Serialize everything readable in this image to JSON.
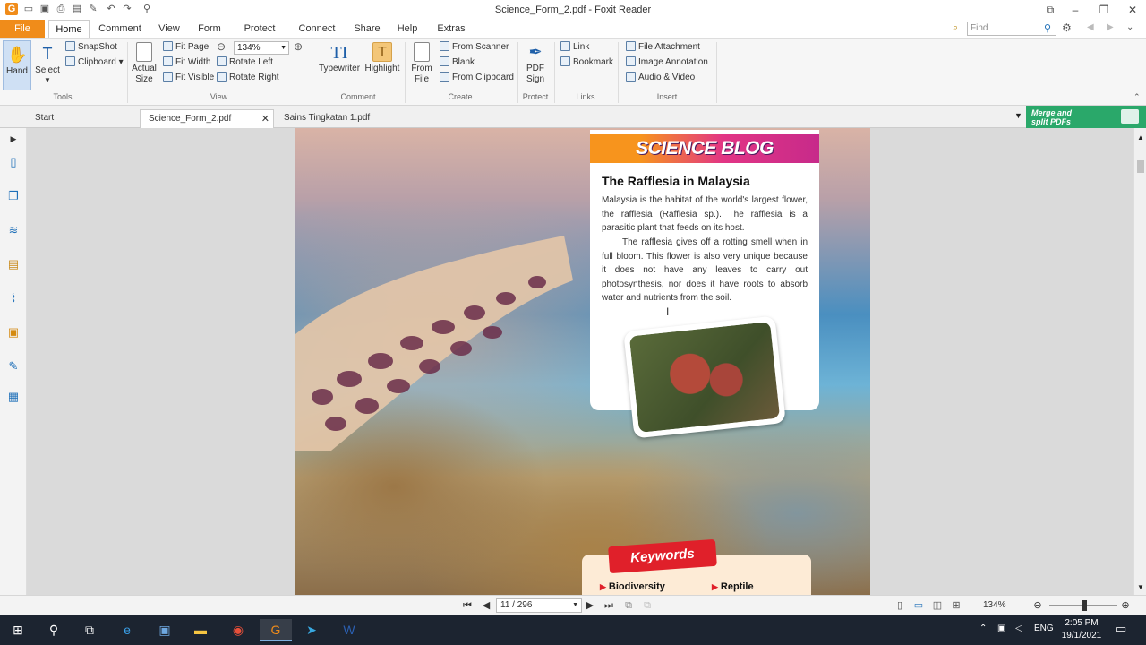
{
  "window": {
    "title": "Science_Form_2.pdf - Foxit Reader"
  },
  "menu": {
    "tabs": [
      "File",
      "Home",
      "Comment",
      "View",
      "Form",
      "Protect",
      "Connect",
      "Share",
      "Help",
      "Extras"
    ],
    "find_placeholder": "Find"
  },
  "ribbon": {
    "hand": "Hand",
    "select": "Select",
    "snapshot": "SnapShot",
    "clipboard": "Clipboard",
    "actual_size": "Actual Size",
    "fit_page": "Fit Page",
    "fit_width": "Fit Width",
    "fit_visible": "Fit Visible",
    "zoom_value": "134%",
    "rotate_left": "Rotate Left",
    "rotate_right": "Rotate Right",
    "typewriter": "Typewriter",
    "highlight": "Highlight",
    "from_file": "From File",
    "from_scanner": "From Scanner",
    "blank": "Blank",
    "from_clipboard": "From Clipboard",
    "pdf_sign": "PDF Sign",
    "link": "Link",
    "bookmark": "Bookmark",
    "file_attachment": "File Attachment",
    "image_annotation": "Image Annotation",
    "audio_video": "Audio & Video",
    "groups": {
      "tools": "Tools",
      "view": "View",
      "comment": "Comment",
      "create": "Create",
      "protect": "Protect",
      "links": "Links",
      "insert": "Insert"
    }
  },
  "doc_tabs": [
    "Start",
    "Science_Form_2.pdf",
    "Sains Tingkatan 1.pdf"
  ],
  "promo": {
    "line1": "Merge and",
    "line2": "split PDFs"
  },
  "page": {
    "banner": "SCIENCE BLOG",
    "title": "The Rafflesia in Malaysia",
    "para1": "Malaysia is the habitat of the world's largest flower, the rafflesia (Rafflesia sp.). The rafflesia is a parasitic plant that feeds on its host.",
    "para2": "The rafflesia gives off a rotting smell when in full bloom. This flower is also very unique because it does not have any leaves to carry out photosynthesis, nor does it have roots to absorb water and nutrients from the soil.",
    "keywords_title": "Keywords",
    "keywords": [
      "Biodiversity",
      "Reptile"
    ]
  },
  "status": {
    "page": "11 / 296",
    "zoom": "134%"
  },
  "taskbar": {
    "lang": "ENG",
    "time": "2:05 PM",
    "date": "19/1/2021"
  },
  "colors": {
    "file_tab": "#f08c1a",
    "taskbar": "#1c2430",
    "promo": "#2aa86a",
    "banner_start": "#f7941d",
    "banner_end": "#c72a8a"
  }
}
